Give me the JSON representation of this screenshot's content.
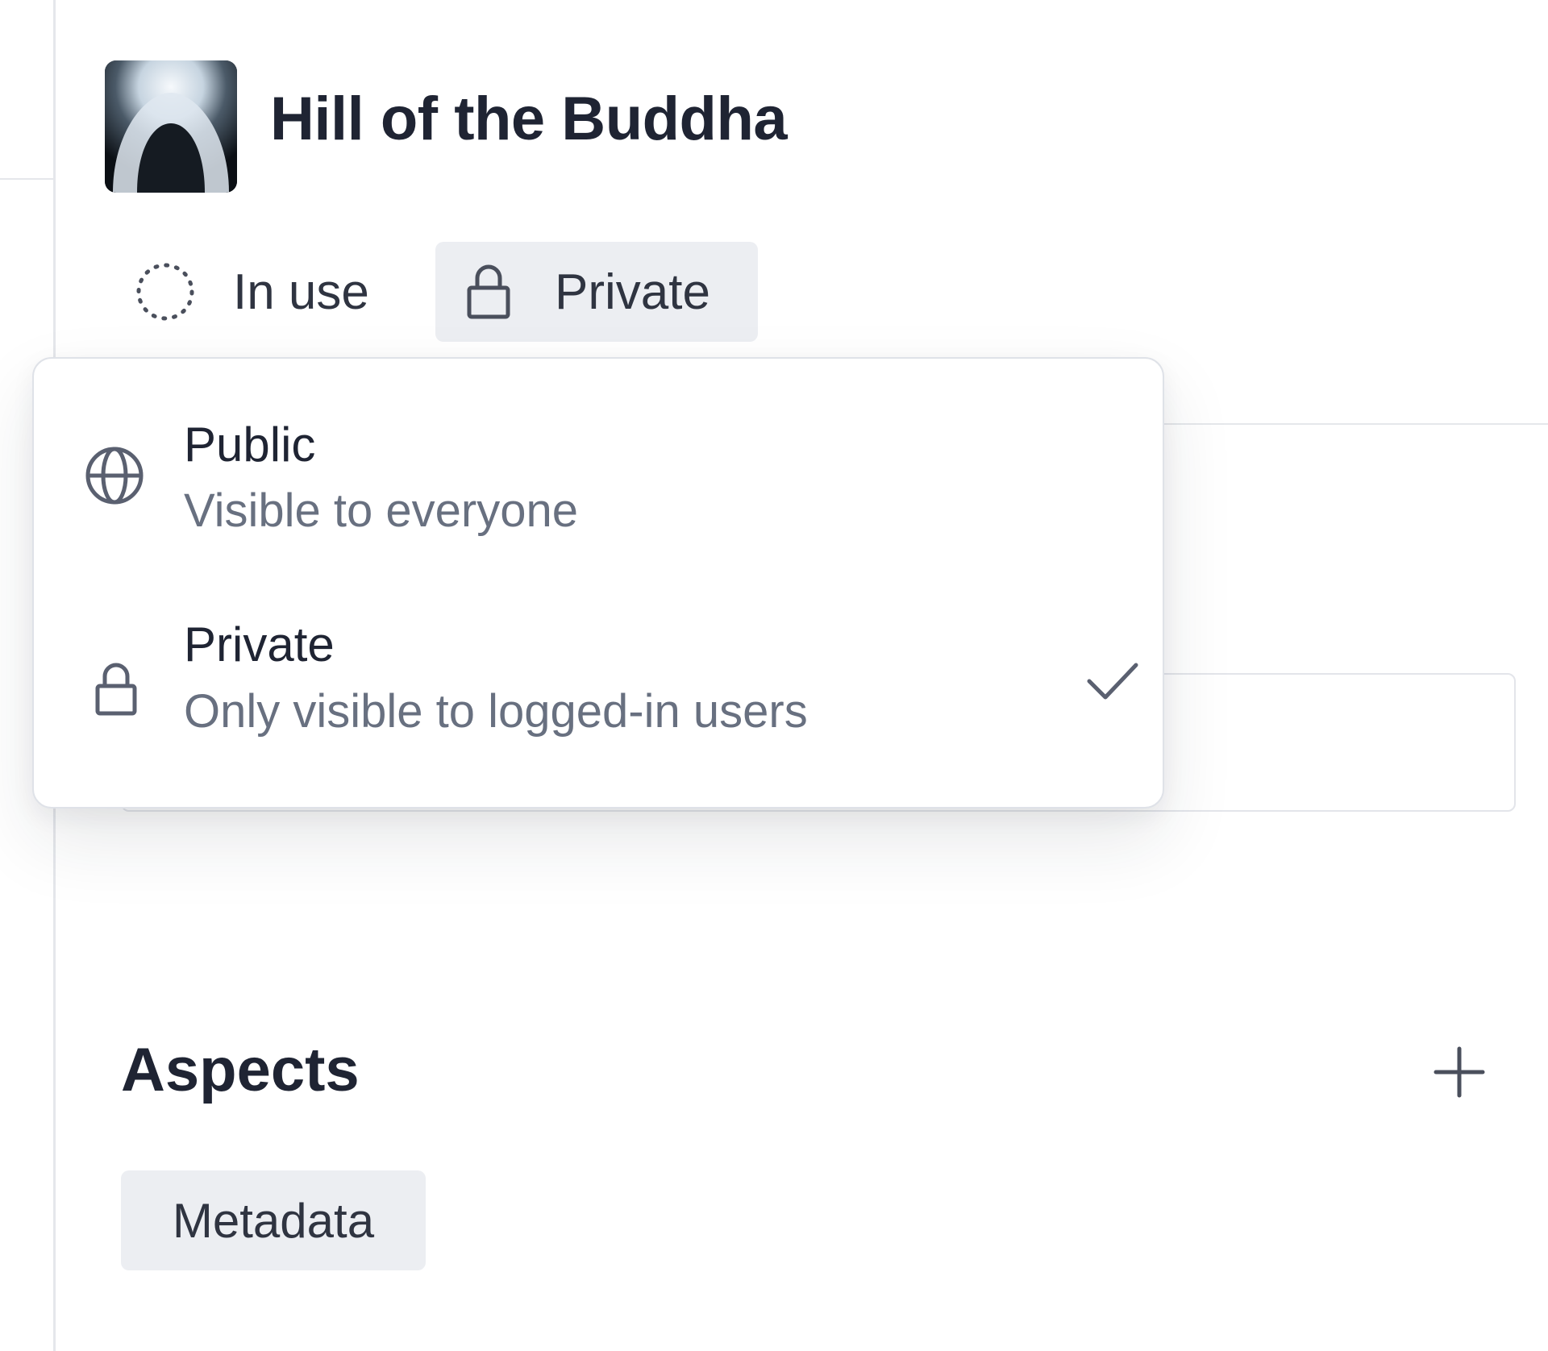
{
  "header": {
    "title": "Hill of the Buddha",
    "thumbnail_icon": "image-thumbnail"
  },
  "status": {
    "label": "In use",
    "icon": "dotted-circle-icon"
  },
  "visibility": {
    "selected_label": "Private",
    "icon": "lock-icon",
    "options": [
      {
        "title": "Public",
        "description": "Visible to everyone",
        "icon": "globe-icon",
        "selected": false
      },
      {
        "title": "Private",
        "description": "Only visible to logged-in users",
        "icon": "lock-icon",
        "selected": true
      }
    ]
  },
  "aspects": {
    "title": "Aspects",
    "add_icon": "plus-icon",
    "tags": [
      "Metadata"
    ]
  },
  "colors": {
    "text": "#1f2433",
    "muted": "#687080",
    "chip_bg": "#eceef2",
    "border": "#dfe2e8"
  }
}
